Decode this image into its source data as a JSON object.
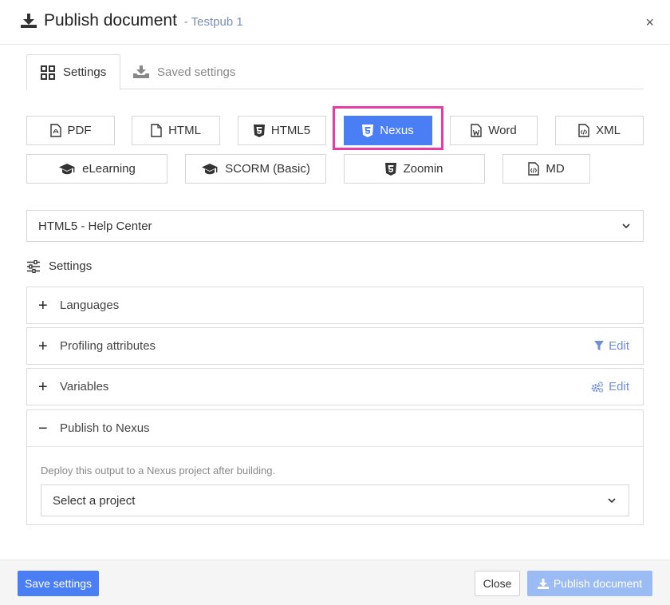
{
  "header": {
    "title": "Publish document",
    "subtitle": "- Testpub 1",
    "close_glyph": "×"
  },
  "tabs": [
    {
      "label": "Settings",
      "icon": "grid-icon",
      "active": true
    },
    {
      "label": "Saved settings",
      "icon": "tray-download-icon",
      "active": false
    }
  ],
  "formats": [
    {
      "label": "PDF",
      "icon": "pdf-file-icon"
    },
    {
      "label": "HTML",
      "icon": "file-icon"
    },
    {
      "label": "HTML5",
      "icon": "html5-icon"
    },
    {
      "label": "Nexus",
      "icon": "html5-icon",
      "selected": true
    },
    {
      "label": "Word",
      "icon": "word-file-icon"
    },
    {
      "label": "XML",
      "icon": "code-file-icon"
    },
    {
      "label": "eLearning",
      "icon": "graduation-cap-icon"
    },
    {
      "label": "SCORM (Basic)",
      "icon": "graduation-cap-icon"
    },
    {
      "label": "Zoomin",
      "icon": "html5-icon"
    },
    {
      "label": "MD",
      "icon": "code-file-icon"
    }
  ],
  "template_select": {
    "value": "HTML5 - Help Center"
  },
  "settings": {
    "heading": "Settings",
    "panels": [
      {
        "title": "Languages",
        "expanded": false
      },
      {
        "title": "Profiling attributes",
        "expanded": false,
        "action": "Edit",
        "action_icon": "filter-icon"
      },
      {
        "title": "Variables",
        "expanded": false,
        "action": "Edit",
        "action_icon": "gears-icon"
      },
      {
        "title": "Publish to Nexus",
        "expanded": true,
        "description": "Deploy this output to a Nexus project after building.",
        "select_value": "Select a project"
      }
    ]
  },
  "footer": {
    "save_label": "Save settings",
    "close_label": "Close",
    "publish_label": "Publish document"
  },
  "colors": {
    "primary": "#4a7ef5",
    "highlight": "#e83ba5",
    "link": "#6f8fd8",
    "disabled_primary": "#9bbbf5"
  }
}
